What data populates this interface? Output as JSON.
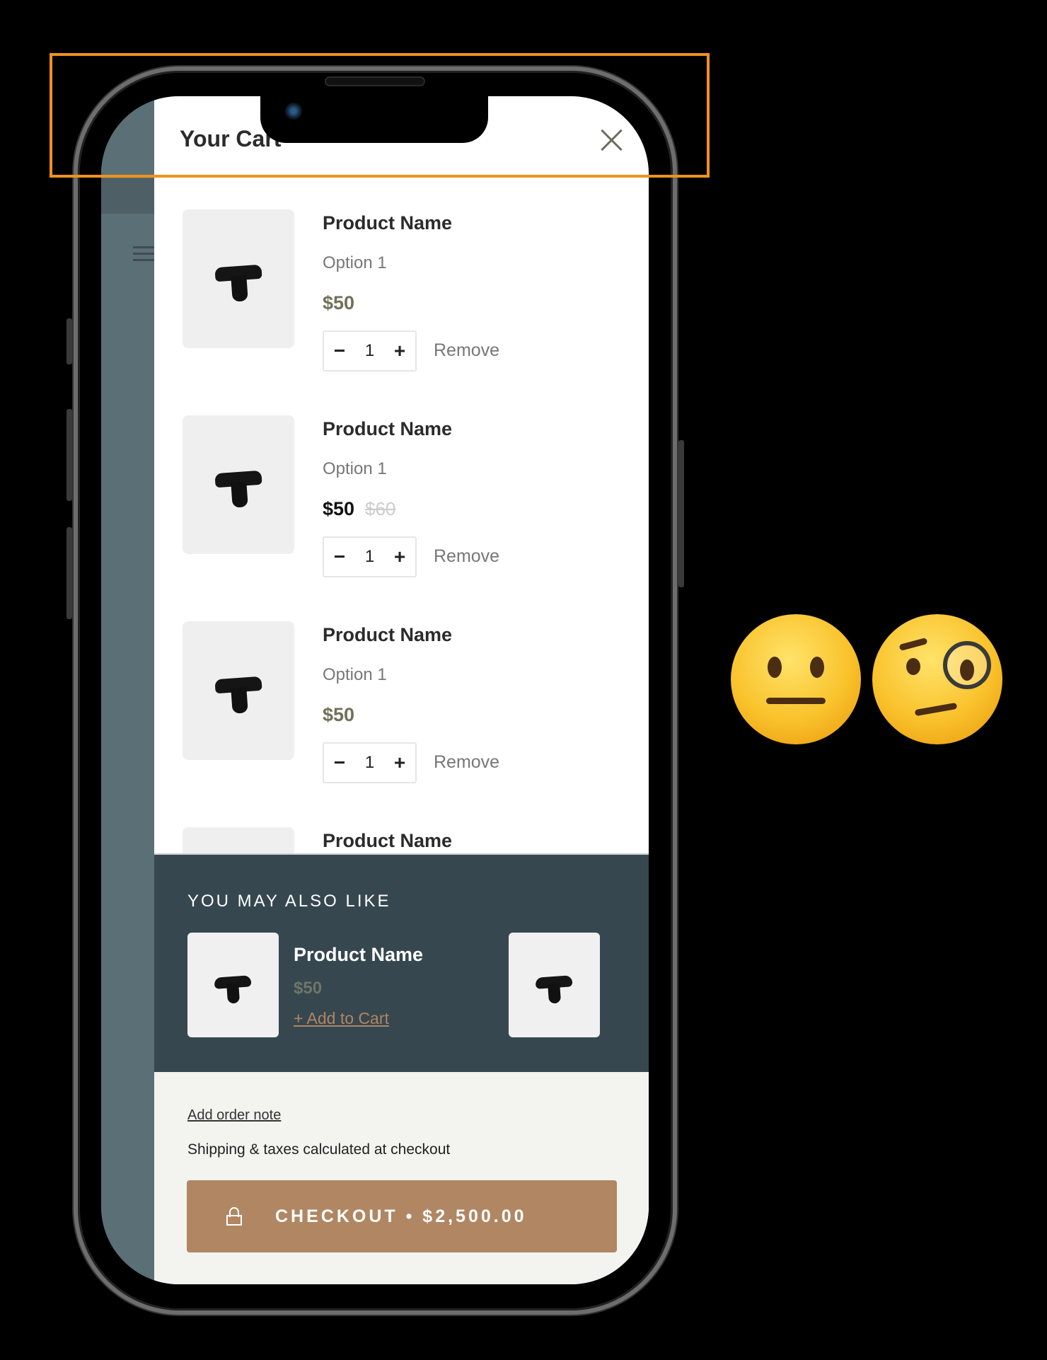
{
  "cart": {
    "title": "Your Cart",
    "items": [
      {
        "name": "Product Name",
        "option": "Option 1",
        "price": "$50",
        "compare_price": "",
        "quantity": "1",
        "remove_label": "Remove"
      },
      {
        "name": "Product Name",
        "option": "Option 1",
        "price": "$50",
        "compare_price": "$60",
        "quantity": "1",
        "remove_label": "Remove"
      },
      {
        "name": "Product Name",
        "option": "Option 1",
        "price": "$50",
        "compare_price": "",
        "quantity": "1",
        "remove_label": "Remove"
      },
      {
        "name": "Product Name"
      }
    ]
  },
  "recommendations": {
    "heading": "YOU MAY ALSO LIKE",
    "items": [
      {
        "name": "Product Name",
        "price": "$50",
        "add_label": "+ Add to Cart"
      }
    ]
  },
  "footer": {
    "order_note_label": "Add order note",
    "shipping_text": "Shipping & taxes calculated at checkout",
    "checkout_label": "CHECKOUT • $2,500.00"
  },
  "icons": {
    "close": "close-icon",
    "lock": "lock-icon",
    "minus": "minus-icon",
    "plus": "plus-icon"
  },
  "colors": {
    "accent": "#b08663",
    "price": "#6f7257",
    "recs_bg": "#36474f",
    "footer_bg": "#f3f3ef",
    "highlight": "#f0921c"
  },
  "emojis": [
    "neutral-face",
    "face-with-monocle"
  ]
}
